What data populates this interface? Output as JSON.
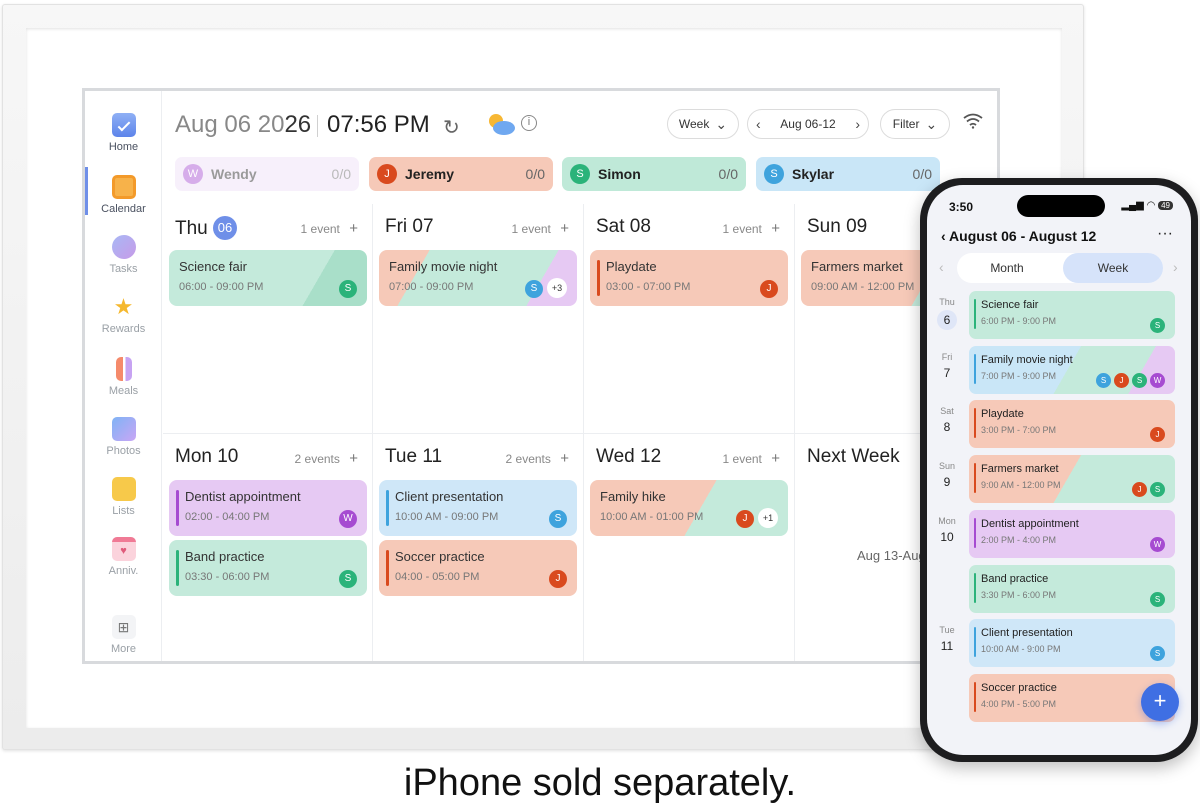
{
  "header": {
    "date_prefix": "Aug 06 20",
    "date_suffix": "26",
    "time": "07:56 PM",
    "view_select": "Week",
    "range": "Aug 06-12",
    "filter": "Filter"
  },
  "sidebar": {
    "items": [
      {
        "label": "Home",
        "icon": "calendar-check-icon"
      },
      {
        "label": "Calendar",
        "icon": "calendar-grid-icon"
      },
      {
        "label": "Tasks",
        "icon": "check-circle-icon"
      },
      {
        "label": "Rewards",
        "icon": "star-icon"
      },
      {
        "label": "Meals",
        "icon": "utensils-icon"
      },
      {
        "label": "Photos",
        "icon": "photo-icon"
      },
      {
        "label": "Lists",
        "icon": "list-icon"
      },
      {
        "label": "Anniv.",
        "icon": "anniversary-calendar-icon"
      },
      {
        "label": "More",
        "icon": "grid-icon"
      }
    ]
  },
  "members": [
    {
      "initial": "W",
      "name": "Wendy",
      "count": "0/0",
      "color": "#a64bd1",
      "bg": "#eedff7"
    },
    {
      "initial": "J",
      "name": "Jeremy",
      "count": "0/0",
      "color": "#d94a1e",
      "bg": "#f6c9b8"
    },
    {
      "initial": "S",
      "name": "Simon",
      "count": "0/0",
      "color": "#2bb37a",
      "bg": "#bfe9d8"
    },
    {
      "initial": "S",
      "name": "Skylar",
      "count": "0/0",
      "color": "#3ea3dd",
      "bg": "#c9e6f7"
    }
  ],
  "days": [
    {
      "name": "Thu",
      "num": "06",
      "today": true,
      "count": "1 event"
    },
    {
      "name": "Fri 07",
      "count": "1 event"
    },
    {
      "name": "Sat 08",
      "count": "1 event"
    },
    {
      "name": "Sun 09",
      "count": ""
    },
    {
      "name": "Mon 10",
      "count": "2 events"
    },
    {
      "name": "Tue 11",
      "count": "2 events"
    },
    {
      "name": "Wed 12",
      "count": "1 event"
    },
    {
      "name": "Next Week",
      "count": "",
      "range": "Aug 13-Aug"
    }
  ],
  "events": [
    {
      "title": "Science fair",
      "time": "06:00 - 09:00 PM",
      "avatars": [
        "S"
      ],
      "more": ""
    },
    {
      "title": "Family movie night",
      "time": "07:00 - 09:00 PM",
      "avatars": [
        "S"
      ],
      "more": "+3"
    },
    {
      "title": "Playdate",
      "time": "03:00 - 07:00 PM",
      "avatars": [
        "J"
      ],
      "more": ""
    },
    {
      "title": "Farmers market",
      "time": "09:00 AM - 12:00 PM",
      "avatars": [],
      "more": ""
    },
    {
      "title": "Dentist appointment",
      "time": "02:00 - 04:00 PM",
      "avatars": [
        "W"
      ],
      "more": ""
    },
    {
      "title": "Band practice",
      "time": "03:30 - 06:00 PM",
      "avatars": [
        "S"
      ],
      "more": ""
    },
    {
      "title": "Client presentation",
      "time": "10:00 AM - 09:00 PM",
      "avatars": [
        "S"
      ],
      "more": ""
    },
    {
      "title": "Soccer practice",
      "time": "04:00 - 05:00 PM",
      "avatars": [
        "J"
      ],
      "more": ""
    },
    {
      "title": "Family hike",
      "time": "10:00 AM - 01:00 PM",
      "avatars": [
        "J"
      ],
      "more": "+1"
    }
  ],
  "phone": {
    "clock": "3:50",
    "battery": "49",
    "title": "August 06 - August 12",
    "tab_month": "Month",
    "tab_week": "Week",
    "days": [
      {
        "w": "Thu",
        "n": "6"
      },
      {
        "w": "Fri",
        "n": "7"
      },
      {
        "w": "Sat",
        "n": "8"
      },
      {
        "w": "Sun",
        "n": "9"
      },
      {
        "w": "Mon",
        "n": "10"
      },
      {
        "w": "Tue",
        "n": "11"
      }
    ],
    "events": [
      {
        "title": "Science fair",
        "time": "6:00 PM - 9:00 PM",
        "avatars": [
          "S"
        ]
      },
      {
        "title": "Family movie night",
        "time": "7:00 PM - 9:00 PM",
        "avatars": [
          "S",
          "J",
          "S",
          "W"
        ]
      },
      {
        "title": "Playdate",
        "time": "3:00 PM - 7:00 PM",
        "avatars": [
          "J"
        ]
      },
      {
        "title": "Farmers market",
        "time": "9:00 AM - 12:00 PM",
        "avatars": [
          "J",
          "S"
        ]
      },
      {
        "title": "Dentist appointment",
        "time": "2:00 PM - 4:00 PM",
        "avatars": [
          "W"
        ]
      },
      {
        "title": "Band practice",
        "time": "3:30 PM - 6:00 PM",
        "avatars": [
          "S"
        ]
      },
      {
        "title": "Client presentation",
        "time": "10:00 AM - 9:00 PM",
        "avatars": [
          "S"
        ]
      },
      {
        "title": "Soccer practice",
        "time": "4:00 PM - 5:00 PM",
        "avatars": []
      }
    ]
  },
  "caption": "iPhone sold separately.",
  "colors": {
    "accent": "#6f8fe8",
    "fab": "#3f6fe3"
  }
}
